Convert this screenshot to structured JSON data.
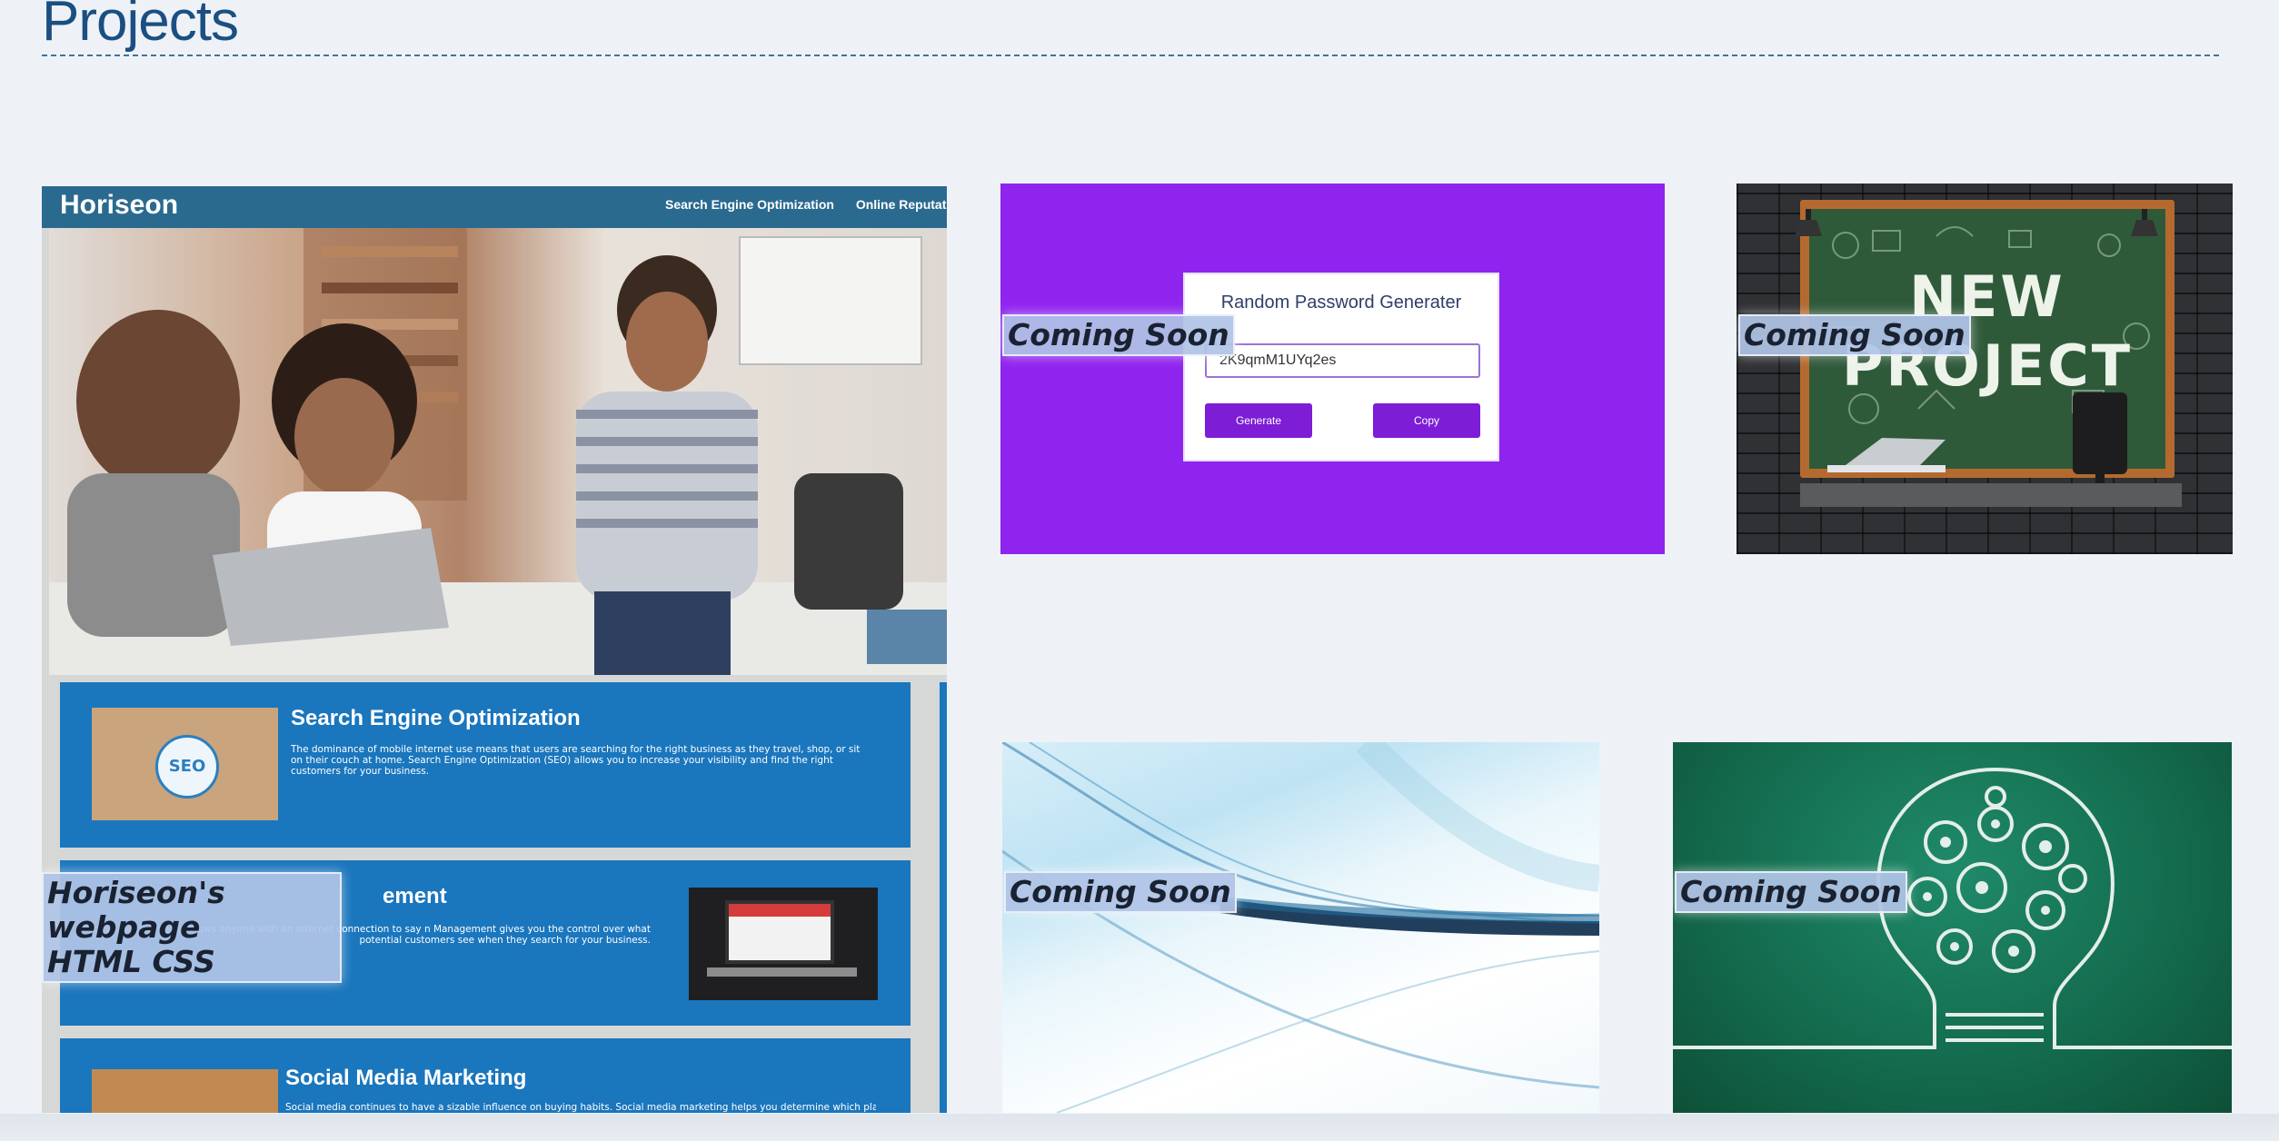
{
  "section": {
    "title": "Projects"
  },
  "projects": [
    {
      "label": "Horiseon's webpage\nHTML CSS",
      "mock": {
        "logo": "Horiseon",
        "nav_links": [
          "Search Engine Optimization",
          "Online Reputation M"
        ],
        "panels": [
          {
            "title": "Search Engine Optimization",
            "text": "The dominance of mobile internet use means that users are searching for the right business as they travel, shop, or sit on their couch at home. Search Engine Optimization (SEO) allows you to increase your visibility and find the right customers for your business."
          },
          {
            "title": "ement",
            "text": "ctive. Social media allows anyone with an internet connection to say n Management gives you the control over what potential customers see when they search for your business."
          },
          {
            "title": "Social Media Marketing",
            "text": "Social media continues to have a sizable influence on buying habits. Social media marketing helps you determine which platforms are"
          }
        ],
        "seo_thumb_text": "SEO"
      }
    },
    {
      "label": "Coming Soon",
      "mock": {
        "title": "Random Password Generater",
        "password_value": "2K9qmM1UYq2es",
        "generate_label": "Generate",
        "copy_label": "Copy"
      }
    },
    {
      "label": "Coming Soon",
      "mock": {
        "board_line1": "NEW",
        "board_line2": "PROJECT"
      }
    },
    {
      "label": "Coming Soon"
    },
    {
      "label": "Coming Soon"
    }
  ],
  "colors": {
    "page_bg": "#eef2f7",
    "title": "#1b4f82",
    "label_bg": "#b0c4e6",
    "horiseon_nav": "#2b6a8f",
    "horiseon_panel": "#1a76bd",
    "password_bg": "#8f24ef",
    "password_button": "#7d1dd6"
  }
}
